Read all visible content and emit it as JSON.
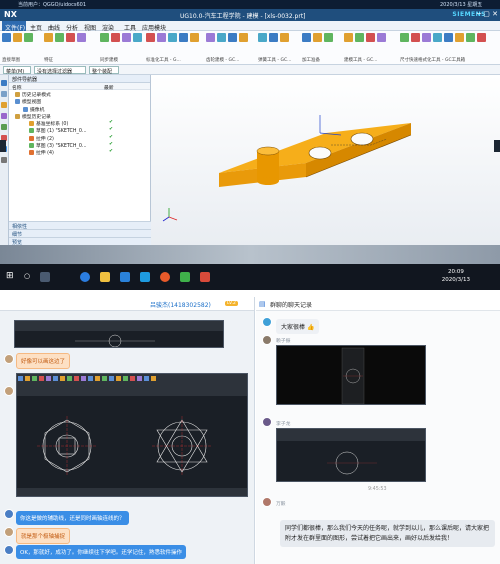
{
  "nx": {
    "window_title_left": "当前用户：QGGO/uidocs601",
    "window_datetime": "2020/3/13 星期五",
    "logo": "NX",
    "title": "UG10.0-汽车工程学院 - 建模 - [xls-0032.prt]",
    "brand": "SIEMENS",
    "menu": [
      "文件(F)",
      "主页",
      "曲线",
      "分析",
      "视图",
      "渲染",
      "工具",
      "应用模块"
    ],
    "ribbon_groups": [
      "直接草图",
      "特征",
      "同步建模",
      "标准化工具 - G...",
      "齿轮建模 - GC...",
      "弹簧工具 - GC...",
      "加工准备",
      "建模工具 - GC...",
      "尺寸快速格式化工具 - GC工具箱"
    ],
    "selection_bar": {
      "menu_label": "菜单(M)",
      "filter": "没有选择过滤器",
      "scope": "整个装配"
    },
    "navigator": {
      "title": "部件导航器",
      "col_name": "名称",
      "col_latest": "最新",
      "nodes": [
        {
          "label": "历史记录模式",
          "check": ""
        },
        {
          "label": "模型视图",
          "check": ""
        },
        {
          "label": "摄像机",
          "check": ""
        },
        {
          "label": "模型历史记录",
          "check": ""
        },
        {
          "label": "基准坐标系 (0)",
          "check": "✔"
        },
        {
          "label": "草图 (1) \"SKETCH_0...",
          "check": "✔"
        },
        {
          "label": "拉伸 (2)",
          "check": "✔"
        },
        {
          "label": "草图 (3) \"SKETCH_0...",
          "check": "✔"
        },
        {
          "label": "拉伸 (4)",
          "check": "✔"
        }
      ],
      "footer": [
        "相依性",
        "细节",
        "预览"
      ]
    },
    "clock_time": "20:09",
    "clock_date": "2020/3/13"
  },
  "chat_left": {
    "title": "吕骏杰(1418302582)",
    "badge": "LV.2",
    "messages": [
      {
        "text": "好像可以画这边了",
        "style": "orange"
      },
      {
        "text": "你这是做的辅助线，还是同时画轴连线的？",
        "style": "blue"
      },
      {
        "text": "就是那个极轴捕捉",
        "style": "orange"
      },
      {
        "text": "OK，那就好，成功了。你继续往下学吧。还学记住，熟悉软件操作",
        "style": "blue"
      }
    ]
  },
  "chat_right": {
    "title": "群聊的聊天记录",
    "sender1": "",
    "msg1": "大家很棒",
    "sender2": "赖子振",
    "sender3": "李子龙",
    "time": "9:45:53",
    "sender4": "万毅",
    "final_message": "同学们都很棒，那么我们今天的任务呢，就学到以儿，那么课后呢，请大家把附才发在群里面的图形，尝试着把它画出来，画好以后发给我！"
  },
  "colors": {
    "accent": "#2e6bb0",
    "part": "#f2a30f",
    "bubble_blue": "#3a8ee6"
  }
}
